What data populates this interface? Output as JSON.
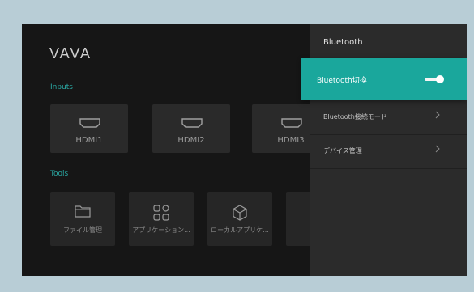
{
  "brand": {
    "logo": "VAVA"
  },
  "home": {
    "inputs_label": "Inputs",
    "inputs": [
      {
        "label": "HDMI1"
      },
      {
        "label": "HDMI2"
      },
      {
        "label": "HDMI3"
      }
    ],
    "tools_label": "Tools",
    "tools": [
      {
        "label": "ファイル管理",
        "icon": "folder-icon"
      },
      {
        "label": "アプリケーション...",
        "icon": "apps-grid-icon"
      },
      {
        "label": "ローカルアプリケ...",
        "icon": "cube-icon"
      }
    ]
  },
  "panel": {
    "title": "Bluetooth",
    "toggle_item": {
      "label": "Bluetooth切換",
      "enabled": true
    },
    "items": [
      {
        "label": "Bluetooth接続モード",
        "icon": "chevron-right-icon"
      },
      {
        "label": "デバイス管理",
        "icon": "chevron-right-icon"
      }
    ],
    "accent": "#1aa79c"
  }
}
